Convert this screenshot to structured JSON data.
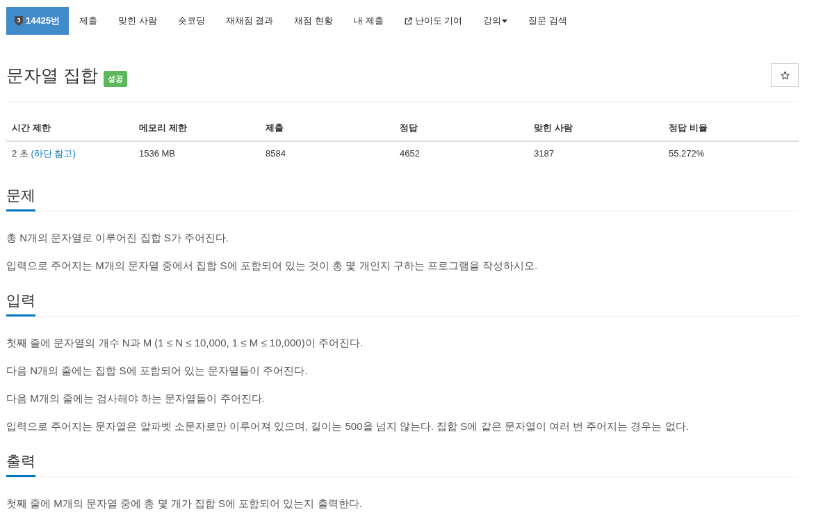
{
  "nav": {
    "tabs": [
      {
        "kind": "problem",
        "badge": "3",
        "label": "14425번",
        "selected": true
      },
      {
        "kind": "link",
        "label": "제출",
        "selected": false
      },
      {
        "kind": "link",
        "label": "맞힌 사람",
        "selected": false
      },
      {
        "kind": "link",
        "label": "숏코딩",
        "selected": false
      },
      {
        "kind": "link",
        "label": "재채점 결과",
        "selected": false
      },
      {
        "kind": "link",
        "label": "채점 현황",
        "selected": false
      },
      {
        "kind": "link",
        "label": "내 제출",
        "selected": false
      },
      {
        "kind": "external",
        "label": "난이도 기여",
        "selected": false
      },
      {
        "kind": "dropdown",
        "label": "강의",
        "selected": false
      },
      {
        "kind": "link",
        "label": "질문 검색",
        "selected": false
      }
    ]
  },
  "problem": {
    "title": "문자열 집합",
    "status_badge": "성공",
    "starred": false
  },
  "info_table": {
    "columns": [
      "시간 제한",
      "메모리 제한",
      "제출",
      "정답",
      "맞힌 사람",
      "정답 비율"
    ],
    "rows": [
      [
        {
          "text": "2 초",
          "link": "(하단 참고)"
        },
        {
          "text": "1536 MB"
        },
        {
          "text": "8584"
        },
        {
          "text": "4652"
        },
        {
          "text": "3187"
        },
        {
          "text": "55.272%"
        }
      ]
    ]
  },
  "sections": [
    {
      "title": "문제",
      "paragraphs": [
        "총 N개의 문자열로 이루어진 집합 S가 주어진다.",
        "입력으로 주어지는 M개의 문자열 중에서 집합 S에 포함되어 있는 것이 총 몇 개인지 구하는 프로그램을 작성하시오."
      ]
    },
    {
      "title": "입력",
      "paragraphs": [
        "첫째 줄에 문자열의 개수 N과 M (1 ≤ N ≤ 10,000, 1 ≤ M ≤ 10,000)이 주어진다.",
        "다음 N개의 줄에는 집합 S에 포함되어 있는 문자열들이 주어진다.",
        "다음 M개의 줄에는 검사해야 하는 문자열들이 주어진다.",
        "입력으로 주어지는 문자열은 알파벳 소문자로만 이루어져 있으며, 길이는 500을 넘지 않는다. 집합 S에 같은 문자열이 여러 번 주어지는 경우는 없다."
      ]
    },
    {
      "title": "출력",
      "paragraphs": [
        "첫째 줄에 M개의 문자열 중에 총 몇 개가 집합 S에 포함되어 있는지 출력한다."
      ]
    }
  ]
}
